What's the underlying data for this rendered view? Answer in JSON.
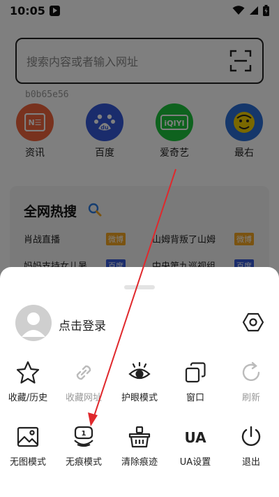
{
  "status": {
    "time": "10:05",
    "icons": [
      "play-badge-icon",
      "wifi-icon",
      "signal-icon",
      "battery-icon"
    ]
  },
  "search": {
    "placeholder": "搜索内容或者输入网址",
    "hash": "b0b65e56"
  },
  "shortcuts": [
    {
      "label": "资讯",
      "icon": "news-icon",
      "color": "#f0643c"
    },
    {
      "label": "百度",
      "icon": "baidu-paw-icon",
      "color": "#3458d8"
    },
    {
      "label": "爱奇艺",
      "icon": "iqiyi-icon",
      "color": "#1cc43c"
    },
    {
      "label": "最右",
      "icon": "zuiyou-icon",
      "color": "#2a6fd6"
    }
  ],
  "hot": {
    "title": "全网热搜",
    "items": [
      {
        "text": "肖战直播",
        "tag": "微博",
        "tag_color": "#f5a623"
      },
      {
        "text": "山姆背叛了山姆",
        "tag": "微博",
        "tag_color": "#f5a623"
      },
      {
        "text": "妈妈支持女儿暑",
        "tag": "百度",
        "tag_color": "#3458d8"
      },
      {
        "text": "中央第九巡视组",
        "tag": "百度",
        "tag_color": "#3458d8"
      }
    ]
  },
  "sheet": {
    "login": "点击登录",
    "menu": [
      {
        "label": "收藏/历史",
        "icon": "star-icon",
        "enabled": true
      },
      {
        "label": "收藏网址",
        "icon": "link-icon",
        "enabled": false
      },
      {
        "label": "护眼模式",
        "icon": "eye-icon",
        "enabled": true
      },
      {
        "label": "窗口",
        "icon": "windows-icon",
        "enabled": true
      },
      {
        "label": "刷新",
        "icon": "refresh-icon",
        "enabled": false
      },
      {
        "label": "无图模式",
        "icon": "image-icon",
        "enabled": true
      },
      {
        "label": "无痕模式",
        "icon": "incognito-icon",
        "enabled": true
      },
      {
        "label": "清除痕迹",
        "icon": "clear-basket-icon",
        "enabled": true
      },
      {
        "label": "UA设置",
        "icon": "ua-icon",
        "enabled": true
      },
      {
        "label": "退出",
        "icon": "power-icon",
        "enabled": true
      }
    ]
  },
  "colors": {
    "overlay": "#000000",
    "annotation_arrow": "#e0282c",
    "disabled_text": "#999999"
  }
}
